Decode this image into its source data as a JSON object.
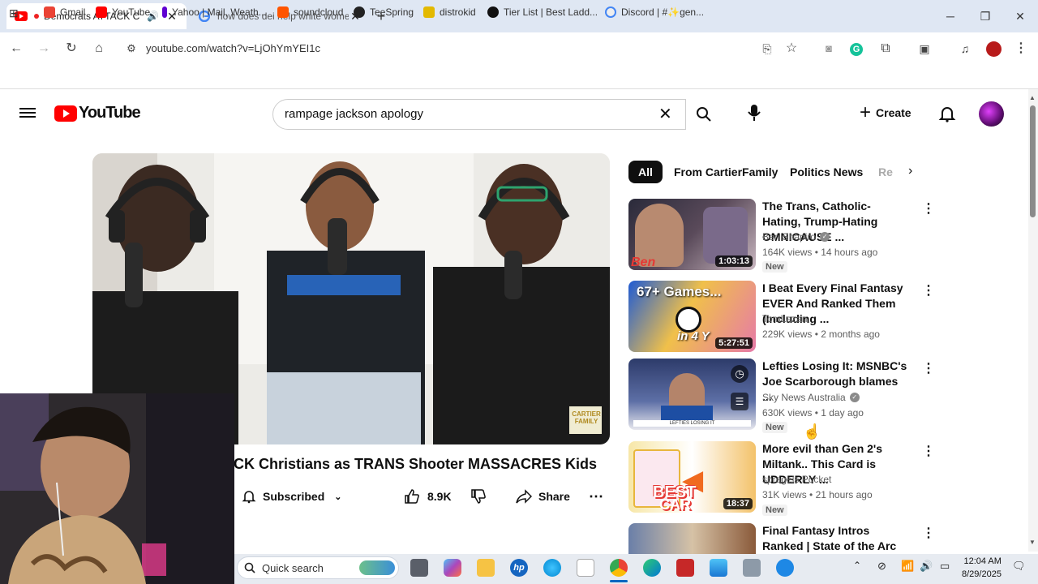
{
  "browser": {
    "tabs": [
      {
        "title": "Democrats ATTACK Chr",
        "active": true
      },
      {
        "title": "how does dei help white wome",
        "active": false
      }
    ],
    "url": "youtube.com/watch?v=LjOhYmYEI1c",
    "bookmarks": [
      "Gmail",
      "YouTube",
      "Yahoo | Mail, Weath...",
      "soundcloud",
      "TeeSpring",
      "distrokid",
      "Tier List | Best Ladd...",
      "Discord | #✨gen..."
    ]
  },
  "youtube": {
    "logo_text": "YouTube",
    "search_value": "rampage jackson apology",
    "create_label": "Create",
    "chips": [
      "All",
      "From CartierFamily",
      "Politics News",
      "Re"
    ],
    "video": {
      "title": "CK Christians as TRANS Shooter MASSACRES Kids",
      "subscribed_label": "Subscribed",
      "likes": "8.9K",
      "share_label": "Share",
      "watermark": "CARTIER FAMILY"
    },
    "recommendations": [
      {
        "title": "The Trans, Catholic-Hating, Trump-Hating OMNICAUSE ...",
        "channel": "Ben Shapiro",
        "verified": true,
        "views": "164K views",
        "age": "14 hours ago",
        "duration": "1:03:13",
        "badge": "New"
      },
      {
        "title": "I Beat Every Final Fantasy EVER And Ranked Them (Including ...",
        "channel": "TomLazan",
        "verified": false,
        "views": "229K views",
        "age": "2 months ago",
        "duration": "5:27:51",
        "badge": ""
      },
      {
        "title": "Lefties Losing It: MSNBC's Joe Scarborough blames ...",
        "channel": "Sky News Australia",
        "verified": true,
        "views": "630K views",
        "age": "1 day ago",
        "duration": "",
        "badge": "New"
      },
      {
        "title": "More evil than Gen 2's Miltank.. This Card is UDDERLY ...",
        "channel": "spragels Pocket",
        "verified": false,
        "views": "31K views",
        "age": "21 hours ago",
        "duration": "18:37",
        "badge": "New"
      },
      {
        "title": "Final Fantasy Intros Ranked | State of the Arc Podcast",
        "channel": "",
        "verified": false,
        "views": "",
        "age": "",
        "duration": "",
        "badge": ""
      }
    ]
  },
  "taskbar": {
    "search_placeholder": "Quick search",
    "time": "12:04 AM",
    "date": "8/29/2025"
  },
  "colors": {
    "youtube_red": "#ff0000",
    "tabbar": "#dfe7f3",
    "chip_active": "#0f0f0f"
  }
}
